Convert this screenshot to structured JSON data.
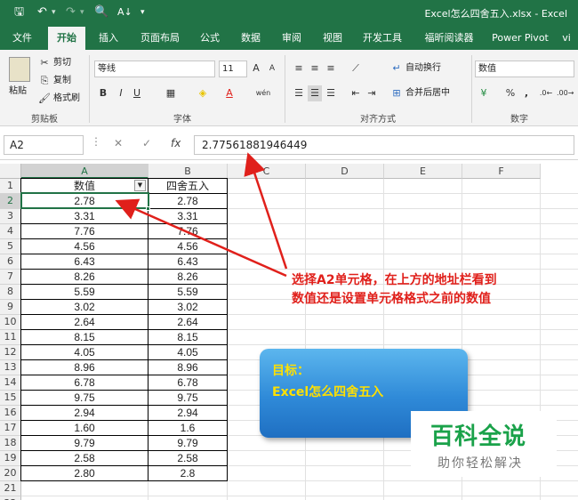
{
  "window": {
    "title": "Excel怎么四舍五入.xlsx - Excel"
  },
  "ribbon_tabs": [
    {
      "label": "文件"
    },
    {
      "label": "开始"
    },
    {
      "label": "插入"
    },
    {
      "label": "页面布局"
    },
    {
      "label": "公式"
    },
    {
      "label": "数据"
    },
    {
      "label": "审阅"
    },
    {
      "label": "视图"
    },
    {
      "label": "开发工具"
    },
    {
      "label": "福昕阅读器"
    },
    {
      "label": "Power Pivot"
    },
    {
      "label": "vi"
    }
  ],
  "active_tab": "开始",
  "clipboard": {
    "paste": "粘贴",
    "cut": "剪切",
    "copy": "复制",
    "format_painter": "格式刷",
    "group": "剪贴板"
  },
  "font": {
    "name": "等线",
    "size": "11",
    "group": "字体",
    "bold": "B",
    "italic": "I",
    "underline": "U",
    "grow": "A",
    "shrink": "A",
    "phonetic": "wén"
  },
  "alignment": {
    "wrap": "自动换行",
    "merge": "合并后居中",
    "group": "对齐方式"
  },
  "number": {
    "format": "数值",
    "group": "数字",
    "percent": "%",
    "comma": ","
  },
  "formula_bar": {
    "name_box": "A2",
    "cancel": "✕",
    "enter": "✓",
    "fx": "fx",
    "value": "2.77561881946449"
  },
  "columns": [
    "A",
    "B",
    "C",
    "D",
    "E",
    "F"
  ],
  "rows": [
    "1",
    "2",
    "3",
    "4",
    "5",
    "6",
    "7",
    "8",
    "9",
    "10",
    "11",
    "12",
    "13",
    "14",
    "15",
    "16",
    "17",
    "18",
    "19",
    "20",
    "21",
    "22"
  ],
  "table": {
    "headers": [
      "数值",
      "四舍五入"
    ],
    "col_a": [
      "2.78",
      "3.31",
      "7.76",
      "4.56",
      "6.43",
      "8.26",
      "5.59",
      "3.02",
      "2.64",
      "8.15",
      "4.05",
      "8.96",
      "6.78",
      "9.75",
      "2.94",
      "1.60",
      "9.79",
      "2.58",
      "2.80"
    ],
    "col_b": [
      "2.78",
      "3.31",
      "7.76",
      "4.56",
      "6.43",
      "8.26",
      "5.59",
      "3.02",
      "2.64",
      "8.15",
      "4.05",
      "8.96",
      "6.78",
      "9.75",
      "2.94",
      "1.6",
      "9.79",
      "2.58",
      "2.8"
    ]
  },
  "annotation": {
    "line1": "选择A2单元格，在上方的地址栏看到",
    "line2": "数值还是设置单元格格式之前的数值",
    "color": "#e0201b"
  },
  "goal_card": {
    "line1": "目标：",
    "line2": "Excel怎么四舍五入"
  },
  "watermark": {
    "title": "百科全说",
    "subtitle": "助你轻松解决"
  },
  "colors": {
    "excel_green": "#217346",
    "arrow_red": "#e0201b",
    "watermark_green": "#1aa24a"
  }
}
